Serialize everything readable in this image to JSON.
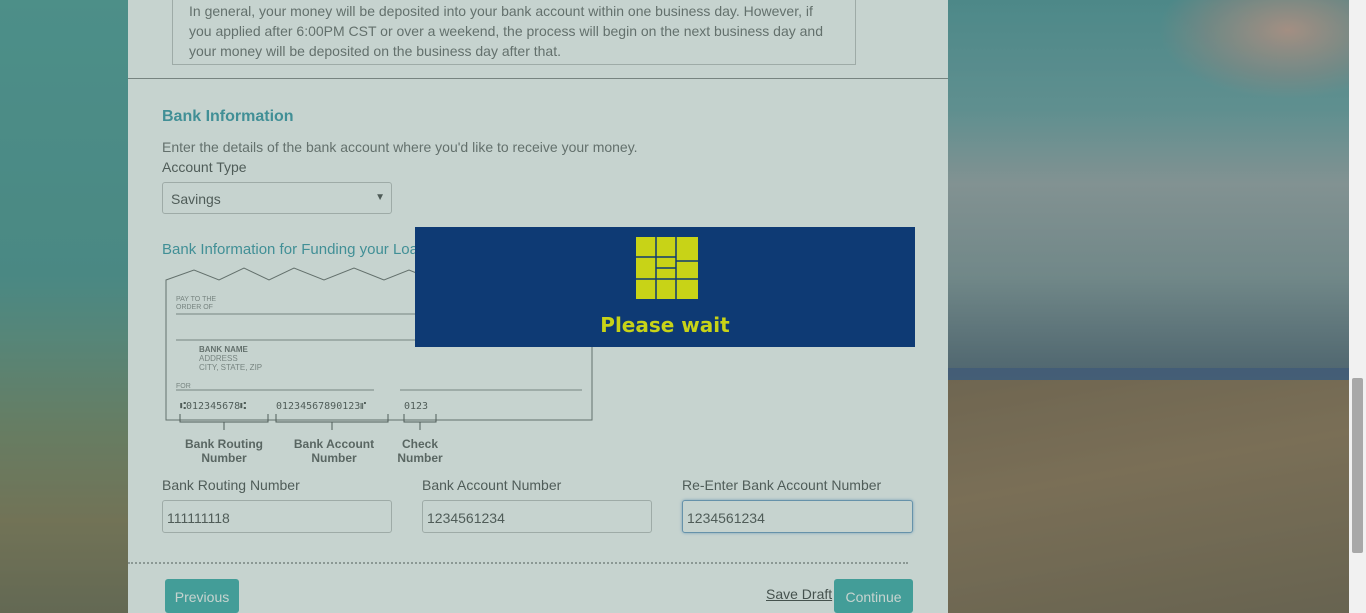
{
  "info_box": {
    "text": "In general, your money will be deposited into your bank account within one business day. However, if you applied after 6:00PM CST or over a weekend, the process will begin on the next business day and your money will be deposited on the business day after that."
  },
  "bank_info": {
    "title": "Bank Information",
    "description": "Enter the details of the bank account where you'd like to receive your money.",
    "account_type_label": "Account Type",
    "account_type_value": "Savings",
    "funding_title": "Bank Information for Funding your Loan"
  },
  "check_image": {
    "pay_to": "PAY TO THE",
    "order_of": "ORDER OF",
    "bank_name": "BANK NAME",
    "address": "ADDRESS",
    "city": "CITY, STATE, ZIP",
    "for": "FOR",
    "micr_routing": "⑆012345678⑆",
    "micr_account": "01234567890123⑈",
    "micr_check": "0123",
    "caption_routing_1": "Bank Routing",
    "caption_routing_2": "Number",
    "caption_account_1": "Bank Account",
    "caption_account_2": "Number",
    "caption_check_1": "Check",
    "caption_check_2": "Number"
  },
  "fields": {
    "routing_label": "Bank Routing Number",
    "routing_value": "111111118",
    "account_label": "Bank Account Number",
    "account_value": "1234561234",
    "reenter_label": "Re-Enter Bank Account Number",
    "reenter_value": "1234561234"
  },
  "actions": {
    "previous": "Previous",
    "save_draft": "Save Draft",
    "continue": "Continue"
  },
  "wait_dialog": {
    "text": "Please wait"
  },
  "colors": {
    "accent": "#1ea3a0",
    "title": "#1a8b9d",
    "dialog_bg": "#0e3a74",
    "dialog_text": "#c8d317"
  }
}
